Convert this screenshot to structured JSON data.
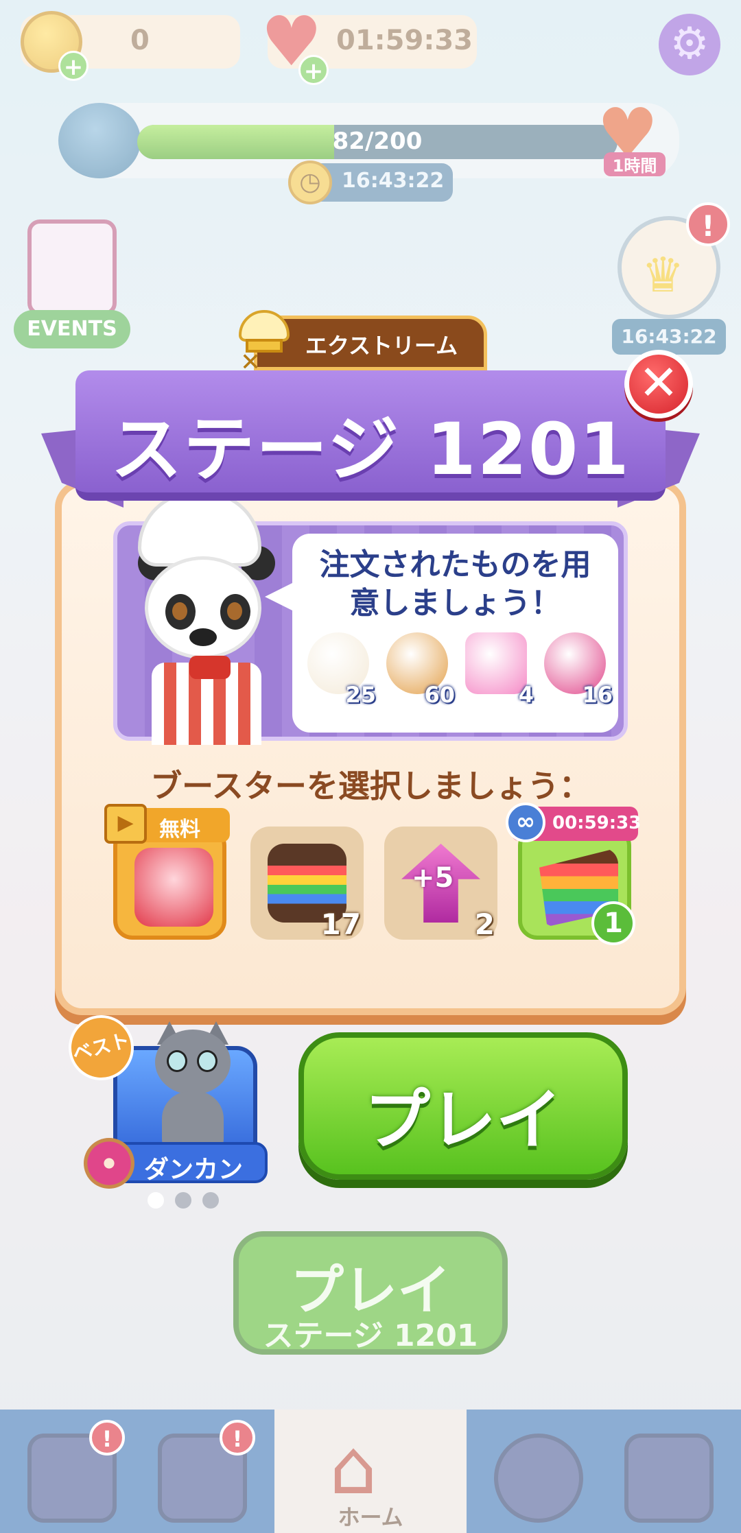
{
  "hud": {
    "coins": "0",
    "lives_timer": "01:59:33",
    "progress_text": "82/200",
    "progress_fraction": 0.41,
    "progress_heart_label": "1時間",
    "event_timer": "16:43:22",
    "events_label": "EVENTS",
    "right_badge_timer": "16:43:22"
  },
  "modal": {
    "difficulty_label": "エクストリーム",
    "title": "ステージ 1201",
    "order_message": "注文されたものを用意しましょう！",
    "orders": [
      {
        "icon": "popcorn-icon",
        "count": "25",
        "color": "#f4ead8"
      },
      {
        "icon": "pretzel-icon",
        "count": "60",
        "color": "#e3a04a"
      },
      {
        "icon": "pink-roll-icon",
        "count": "4",
        "color": "#f58ac6"
      },
      {
        "icon": "donut-icon",
        "count": "16",
        "color": "#e0468a"
      }
    ],
    "booster_prompt": "ブースターを選択しましょう：",
    "boosters": [
      {
        "icon": "gift-box-booster-icon",
        "count": "",
        "tag": "無料"
      },
      {
        "icon": "smore-booster-icon",
        "count": "17",
        "tag": ""
      },
      {
        "icon": "plus-five-moves-icon",
        "count": "2",
        "tag": "+5"
      },
      {
        "icon": "rainbow-cake-icon",
        "count": "1",
        "tag": "00:59:33"
      }
    ],
    "pet": {
      "best_label": "ベスト",
      "name": "ダンカン",
      "page_count": 3,
      "active_page": 0
    },
    "play_label": "プレイ"
  },
  "background": {
    "play_label": "プレイ",
    "stage_label": "ステージ 1201",
    "home_label": "ホーム"
  },
  "colors": {
    "ribbon": "#9a72d8",
    "play_green": "#58c21f",
    "close_red": "#d6242c",
    "card": "#fbe9d6"
  }
}
